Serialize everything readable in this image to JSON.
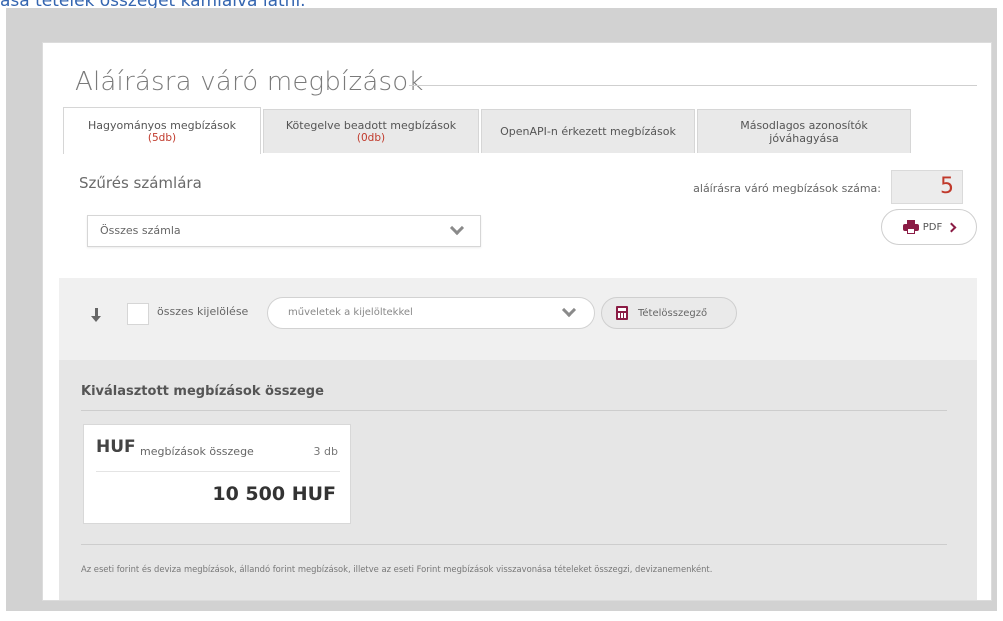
{
  "caption": "ása  tételek összegét kamlálva látni.",
  "page": {
    "title": "Aláírásra váró megbízások"
  },
  "tabs": [
    {
      "label": "Hagyományos megbízások",
      "count": "(5db)"
    },
    {
      "label": "Kötegelve beadott megbízások",
      "count": "(0db)"
    },
    {
      "label": "OpenAPI-n érkezett megbízások"
    },
    {
      "label": "Másodlagos azonosítók jóváhagyása"
    }
  ],
  "filter": {
    "title": "Szűrés számlára",
    "account_value": "Összes számla",
    "pending_label": "aláírásra váró megbízások száma:",
    "pending_count": "5",
    "pdf_label": "PDF"
  },
  "actions": {
    "select_all_label": "összes kijelölése",
    "ops_placeholder": "műveletek a kijelöltekkel",
    "summary_button": "Tételösszegző"
  },
  "summary": {
    "title": "Kiválasztott megbízások összege",
    "card": {
      "currency": "HUF",
      "label": "megbízások összege",
      "count": "3 db",
      "total": "10 500 HUF"
    },
    "footnote": "Az eseti forint és deviza megbízások, állandó forint megbízások, illetve az eseti Forint megbízások visszavonása tételeket összegzi, devizanemenként."
  },
  "colors": {
    "accent": "#8b1c45",
    "count_red": "#c0392b",
    "frame_gray": "#d2d2d2"
  }
}
